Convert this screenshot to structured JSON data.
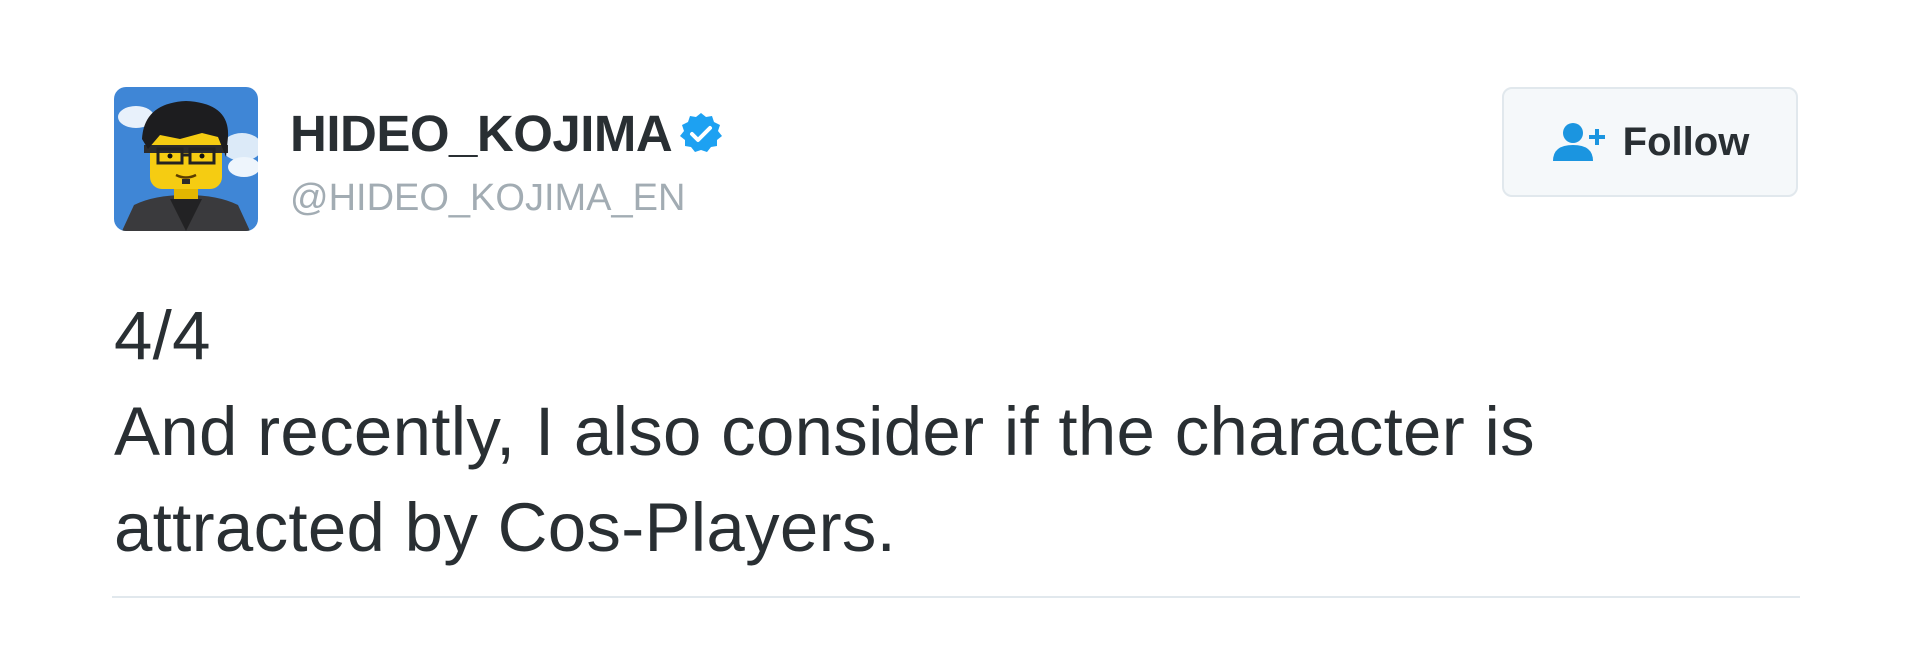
{
  "author": {
    "display_name": "HIDEO_KOJIMA",
    "handle": "@HIDEO_KOJIMA_EN",
    "verified": true,
    "avatar_icon": "lego-minifig-avatar",
    "verified_icon": "verified-badge-icon"
  },
  "follow_button": {
    "label": "Follow",
    "icon": "follow-person-plus-icon"
  },
  "tweet": {
    "lines": [
      "4/4",
      "And recently, I also consider if the character is",
      "attracted by Cos-Players."
    ]
  },
  "colors": {
    "text": "#292f33",
    "handle": "#a2acb3",
    "verified_blue": "#1da1f2",
    "follow_icon": "#1b95e0",
    "button_border": "#e1e8ed",
    "button_bg": "#f5f8fa"
  }
}
